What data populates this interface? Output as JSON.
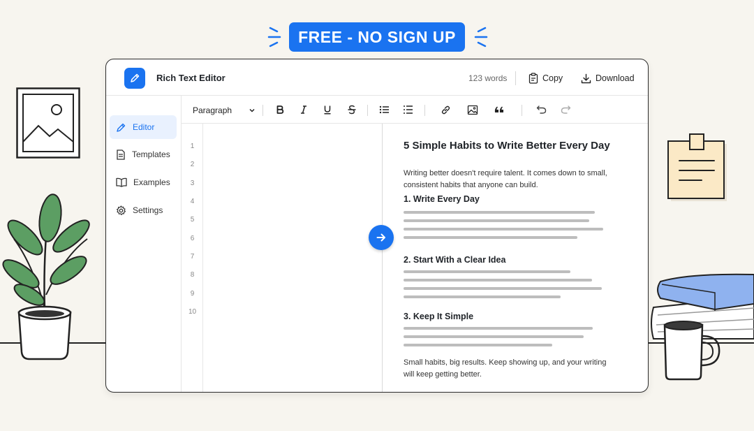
{
  "banner": {
    "text": "FREE - NO SIGN UP"
  },
  "app": {
    "title": "Rich Text Editor",
    "word_count": "123 words",
    "copy_label": "Copy",
    "download_label": "Download"
  },
  "sidebar": {
    "items": [
      {
        "label": "Editor",
        "icon": "pencil-icon",
        "active": true
      },
      {
        "label": "Templates",
        "icon": "document-icon",
        "active": false
      },
      {
        "label": "Examples",
        "icon": "book-icon",
        "active": false
      },
      {
        "label": "Settings",
        "icon": "gear-icon",
        "active": false
      }
    ]
  },
  "toolbar": {
    "block_format": "Paragraph",
    "icons": [
      "bold-icon",
      "italic-icon",
      "underline-icon",
      "strikethrough-icon",
      "bulleted-list-icon",
      "numbered-list-icon",
      "link-icon",
      "image-icon",
      "quote-icon",
      "undo-icon",
      "redo-icon"
    ]
  },
  "gutter": {
    "line_numbers": [
      "1",
      "2",
      "3",
      "4",
      "5",
      "6",
      "7",
      "8",
      "9",
      "10"
    ]
  },
  "preview": {
    "title": "5 Simple Habits to Write Better Every Day",
    "intro": "Writing better doesn't require talent. It comes down to small, consistent habits that anyone can build.",
    "sections": [
      {
        "heading": "1. Write Every Day"
      },
      {
        "heading": "2. Start With a Clear Idea"
      },
      {
        "heading": "3. Keep It Simple"
      }
    ],
    "outro": "Small habits, big results. Keep showing up, and your writing will keep getting better."
  },
  "colors": {
    "accent": "#1a73f0",
    "background": "#f7f5ef",
    "book": "#8fb2ef",
    "note": "#fbe9c6",
    "leaf": "#5c9e63"
  }
}
